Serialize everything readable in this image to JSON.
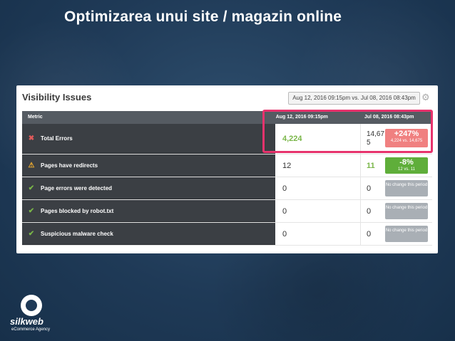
{
  "slide": {
    "title": "Optimizarea unui site / magazin online"
  },
  "panel": {
    "title": "Visibility Issues",
    "date_range": "Aug 12, 2016 09:15pm vs. Jul 08, 2016 08:43pm",
    "settings_icon": "gear-icon"
  },
  "table": {
    "headers": [
      "Metric",
      "Aug 12, 2016 09:15pm",
      "Jul 08, 2016 08:43pm"
    ],
    "rows": [
      {
        "icon": "x-icon",
        "icon_color": "#e05a5a",
        "metric": "Total Errors",
        "current": "4,224",
        "previous": "14,675",
        "badge_main": "+247%",
        "badge_sub": "4,224 vs. 14,675",
        "badge_color": "#f08080"
      },
      {
        "icon": "warning-icon",
        "icon_color": "#f0ad2f",
        "metric": "Pages have redirects",
        "current": "12",
        "previous": "11",
        "badge_main": "-8%",
        "badge_sub": "12 vs. 11",
        "badge_color": "#5fae3a"
      },
      {
        "icon": "check-icon",
        "icon_color": "#7ab648",
        "metric": "Page errors were detected",
        "current": "0",
        "previous": "0",
        "badge_text": "No change this period"
      },
      {
        "icon": "check-icon",
        "icon_color": "#7ab648",
        "metric": "Pages blocked by robot.txt",
        "current": "0",
        "previous": "0",
        "badge_text": "No change this period"
      },
      {
        "icon": "check-icon",
        "icon_color": "#7ab648",
        "metric": "Suspicious malware check",
        "current": "0",
        "previous": "0",
        "badge_text": "No change this period"
      }
    ]
  },
  "brand": {
    "name": "silkweb",
    "tagline": "eCommerce Agency",
    "logo_icon": "silkweb-logo-icon"
  },
  "colors": {
    "background": "#1f3a57",
    "highlight": "#e7336d",
    "metric_cell": "#3b3f44",
    "header": "#555b62"
  }
}
